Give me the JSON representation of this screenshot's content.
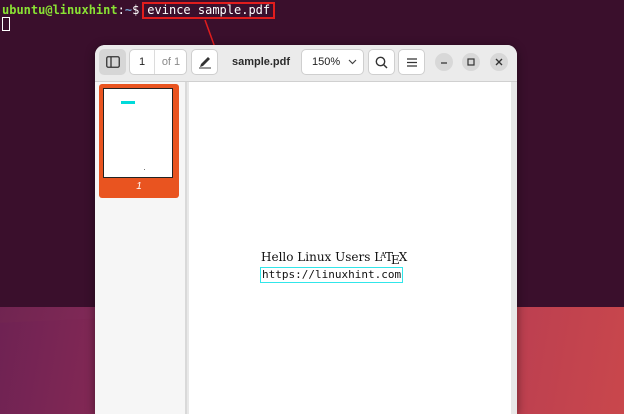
{
  "terminal": {
    "user_host": "ubuntu@linuxhint",
    "separator": ":",
    "path": "~",
    "dollar": "$",
    "command": "evince sample.pdf"
  },
  "window": {
    "title": "sample.pdf",
    "page_current": "1",
    "page_total": "of 1",
    "zoom": "150%"
  },
  "sidebar": {
    "thumb_label": "1"
  },
  "document": {
    "line1": "Hello Linux Users",
    "latex_L": "L",
    "latex_A": "A",
    "latex_T": "T",
    "latex_E": "E",
    "latex_X": "X",
    "link": "https://linuxhint.com"
  },
  "colors": {
    "accent_orange": "#e95420",
    "annotation_red": "#e11d1d",
    "link_border": "#31e6ea"
  },
  "icons": [
    "sidebar-icon",
    "pen-icon",
    "search-icon",
    "hamburger-menu-icon",
    "minimize-icon",
    "maximize-icon",
    "close-icon",
    "dropdown-chevron-icon"
  ]
}
